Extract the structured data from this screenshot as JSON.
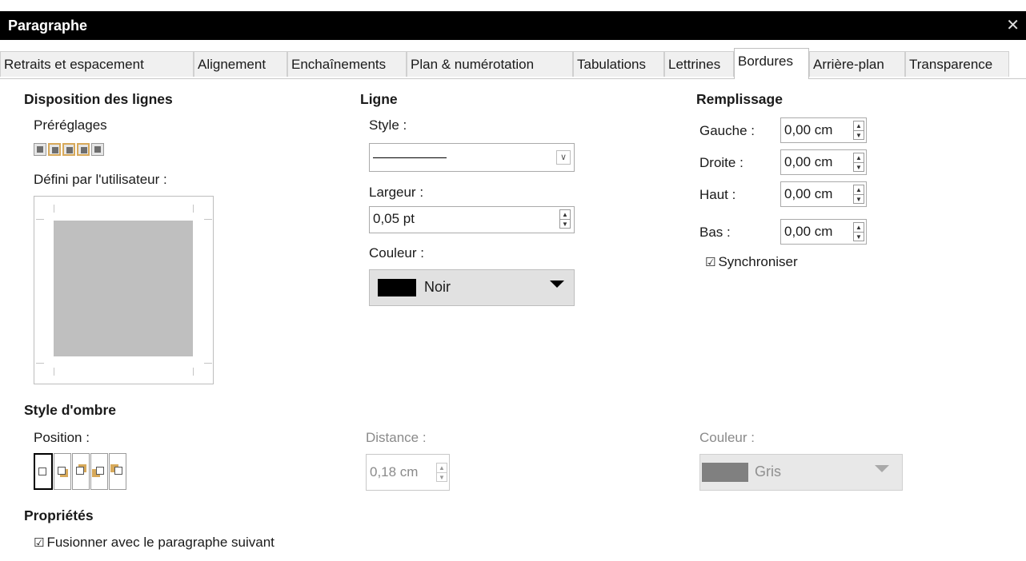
{
  "window": {
    "title": "Paragraphe",
    "close_glyph": "✕"
  },
  "tabs": [
    {
      "label": "Retraits et espacement",
      "active": false
    },
    {
      "label": "Alignement",
      "active": false
    },
    {
      "label": "Enchaînements",
      "active": false
    },
    {
      "label": "Plan & numérotation",
      "active": false
    },
    {
      "label": "Tabulations",
      "active": false
    },
    {
      "label": "Lettrines",
      "active": false
    },
    {
      "label": "Bordures",
      "active": true
    },
    {
      "label": "Arrière-plan",
      "active": false
    },
    {
      "label": "Transparence",
      "active": false
    }
  ],
  "line_arrangement": {
    "title": "Disposition des lignes",
    "presets_label": "Préréglages",
    "user_defined_label": "Défini par l'utilisateur :"
  },
  "line": {
    "title": "Ligne",
    "style_label": "Style :",
    "width_label": "Largeur :",
    "width_value": "0,05 pt",
    "color_label": "Couleur :",
    "color_name": "Noir",
    "color_hex": "#000000"
  },
  "padding": {
    "title": "Remplissage",
    "left_label": "Gauche :",
    "left_value": "0,00 cm",
    "right_label": "Droite :",
    "right_value": "0,00 cm",
    "top_label": "Haut :",
    "top_value": "0,00 cm",
    "bottom_label": "Bas :",
    "bottom_value": "0,00 cm",
    "sync_label": "Synchroniser",
    "sync_checked": true
  },
  "shadow": {
    "title": "Style d'ombre",
    "position_label": "Position :",
    "distance_label": "Distance :",
    "distance_value": "0,18 cm",
    "color_label": "Couleur :",
    "color_name": "Gris",
    "color_hex": "#808080"
  },
  "properties": {
    "title": "Propriétés",
    "merge_label": "Fusionner avec le paragraphe suivant",
    "merge_checked": true
  }
}
